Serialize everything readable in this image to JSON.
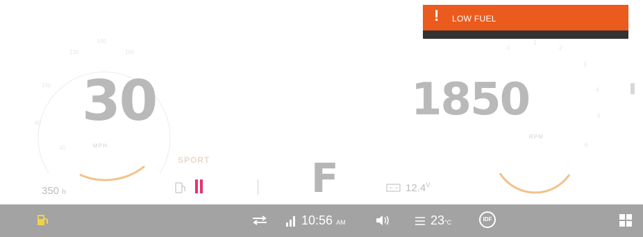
{
  "speed": {
    "value": "30",
    "unit": "MPH",
    "mode": "SPORT"
  },
  "rpm": {
    "value": "1850",
    "unit": "RPM"
  },
  "range": {
    "value": "350",
    "unit": "h"
  },
  "gear": "F",
  "battery": {
    "voltage": "12.4",
    "unit": "V"
  },
  "alert": {
    "text": "LOW FUEL",
    "icon": "exclamation-icon",
    "color": "#ea5b1d"
  },
  "status_bar": {
    "time": "10:56",
    "ampm": "AM",
    "temperature": "23",
    "temp_unit": "°C",
    "badge": "IDF"
  },
  "colors": {
    "accent": "#f3b25c",
    "fuel_warning": "#e5336e",
    "statusbar": "#a3a3a3"
  }
}
